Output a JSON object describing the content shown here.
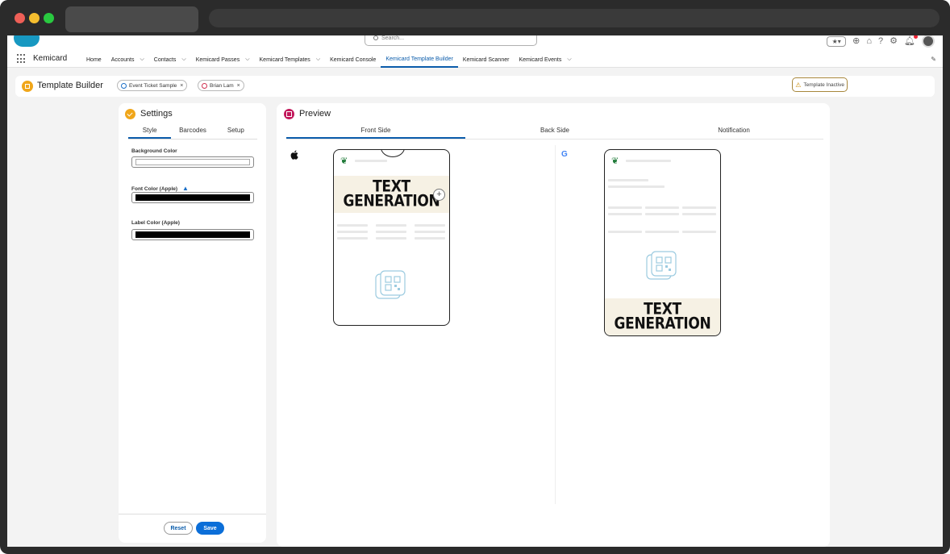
{
  "browser": {},
  "header": {
    "search_placeholder": "Search...",
    "icons": [
      "favorites-icon",
      "add-icon",
      "trailhead-icon",
      "help-icon",
      "settings-icon",
      "notifications-icon",
      "avatar"
    ]
  },
  "nav": {
    "app_name": "Kemicard",
    "items": [
      {
        "label": "Home",
        "dropdown": false
      },
      {
        "label": "Accounts",
        "dropdown": true
      },
      {
        "label": "Contacts",
        "dropdown": true
      },
      {
        "label": "Kemicard Passes",
        "dropdown": true
      },
      {
        "label": "Kemicard Templates",
        "dropdown": true
      },
      {
        "label": "Kemicard Console",
        "dropdown": false
      },
      {
        "label": "Kemicard Template Builder",
        "dropdown": false,
        "active": true
      },
      {
        "label": "Kemicard Scanner",
        "dropdown": false
      },
      {
        "label": "Kemicard Events",
        "dropdown": true
      }
    ]
  },
  "page": {
    "title": "Template Builder",
    "pill_template": "Event Ticket Sample",
    "pill_user": "Brian Lam",
    "status": "Template Inactive"
  },
  "settings": {
    "title": "Settings",
    "tabs": [
      "Style",
      "Barcodes",
      "Setup"
    ],
    "active_tab": "Style",
    "fields": [
      {
        "label": "Background Color",
        "value_color": "#ffffff"
      },
      {
        "label": "Font Color (Apple)",
        "value_color": "#000000",
        "warning": true
      },
      {
        "label": "Label Color (Apple)",
        "value_color": "#000000"
      }
    ],
    "reset_label": "Reset",
    "save_label": "Save"
  },
  "preview": {
    "title": "Preview",
    "tabs": [
      "Front Side",
      "Back Side",
      "Notification"
    ],
    "active_tab": "Front Side",
    "banner_line1": "TEXT",
    "banner_line2": "GENERATION"
  },
  "colors": {
    "accent": "#0b5cab",
    "brand_orange": "#f0a61a",
    "preview_icon": "#c2185b",
    "leaf_green": "#1f7a38",
    "qr_blue": "#9ccbe0"
  }
}
